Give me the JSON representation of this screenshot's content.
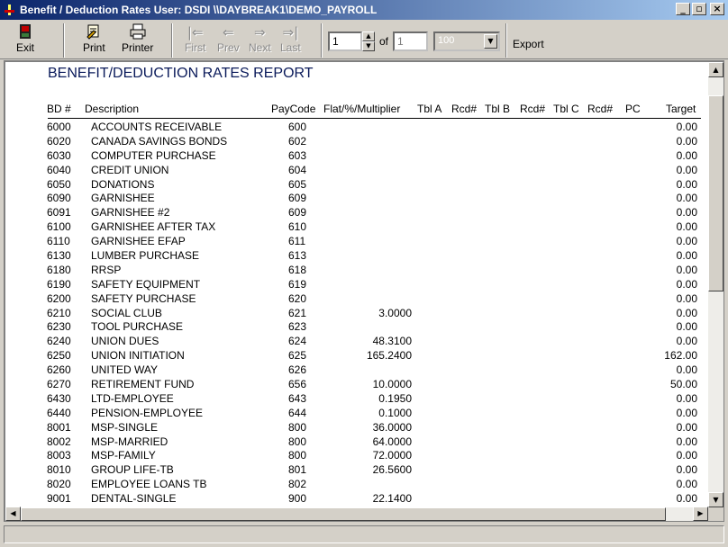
{
  "window": {
    "title": "Benefit / Deduction Rates  User: DSDI  \\\\DAYBREAK1\\DEMO_PAYROLL",
    "minimize": "_",
    "maximize": "▫",
    "close": "×"
  },
  "toolbar": {
    "exit": "Exit",
    "print": "Print",
    "printer": "Printer",
    "first": "First",
    "prev": "Prev",
    "next": "Next",
    "last": "Last",
    "page_value": "1",
    "of_label": "of",
    "total_pages": "1",
    "zoom_value": "100",
    "export": "Export"
  },
  "icons": {
    "exit": "exit-door-icon",
    "print": "print-preview-icon",
    "printer": "printer-icon",
    "first": "first-page-icon",
    "prev": "prev-arrow-icon",
    "next": "next-arrow-icon",
    "last": "last-page-icon"
  },
  "report": {
    "title": "BENEFIT/DEDUCTION RATES REPORT",
    "columns": {
      "bd": "BD  #",
      "description": "Description",
      "paycode": "PayCode",
      "flat": "Flat/%/Multiplier",
      "tbl_a": "Tbl A",
      "rcd1": "Rcd#",
      "tbl_b": "Tbl B",
      "rcd2": "Rcd#",
      "tbl_c": "Tbl C",
      "rcd3": "Rcd#",
      "pc": "PC",
      "target": "Target"
    },
    "rows": [
      {
        "bd": "6000",
        "desc": "ACCOUNTS RECEIVABLE",
        "paycode": "600",
        "flat": "",
        "target": "0.00"
      },
      {
        "bd": "6020",
        "desc": "CANADA SAVINGS BONDS",
        "paycode": "602",
        "flat": "",
        "target": "0.00"
      },
      {
        "bd": "6030",
        "desc": "COMPUTER PURCHASE",
        "paycode": "603",
        "flat": "",
        "target": "0.00"
      },
      {
        "bd": "6040",
        "desc": "CREDIT UNION",
        "paycode": "604",
        "flat": "",
        "target": "0.00"
      },
      {
        "bd": "6050",
        "desc": "DONATIONS",
        "paycode": "605",
        "flat": "",
        "target": "0.00"
      },
      {
        "bd": "6090",
        "desc": "GARNISHEE",
        "paycode": "609",
        "flat": "",
        "target": "0.00"
      },
      {
        "bd": "6091",
        "desc": "GARNISHEE #2",
        "paycode": "609",
        "flat": "",
        "target": "0.00"
      },
      {
        "bd": "6100",
        "desc": "GARNISHEE AFTER TAX",
        "paycode": "610",
        "flat": "",
        "target": "0.00"
      },
      {
        "bd": "6110",
        "desc": "GARNISHEE EFAP",
        "paycode": "611",
        "flat": "",
        "target": "0.00"
      },
      {
        "bd": "6130",
        "desc": "LUMBER PURCHASE",
        "paycode": "613",
        "flat": "",
        "target": "0.00"
      },
      {
        "bd": "6180",
        "desc": "RRSP",
        "paycode": "618",
        "flat": "",
        "target": "0.00"
      },
      {
        "bd": "6190",
        "desc": "SAFETY EQUIPMENT",
        "paycode": "619",
        "flat": "",
        "target": "0.00"
      },
      {
        "bd": "6200",
        "desc": "SAFETY PURCHASE",
        "paycode": "620",
        "flat": "",
        "target": "0.00"
      },
      {
        "bd": "6210",
        "desc": "SOCIAL CLUB",
        "paycode": "621",
        "flat": "3.0000",
        "target": "0.00"
      },
      {
        "bd": "6230",
        "desc": "TOOL PURCHASE",
        "paycode": "623",
        "flat": "",
        "target": "0.00"
      },
      {
        "bd": "6240",
        "desc": "UNION DUES",
        "paycode": "624",
        "flat": "48.3100",
        "target": "0.00"
      },
      {
        "bd": "6250",
        "desc": "UNION INITIATION",
        "paycode": "625",
        "flat": "165.2400",
        "target": "162.00"
      },
      {
        "bd": "6260",
        "desc": "UNITED WAY",
        "paycode": "626",
        "flat": "",
        "target": "0.00"
      },
      {
        "bd": "6270",
        "desc": "RETIREMENT FUND",
        "paycode": "656",
        "flat": "10.0000",
        "target": "50.00"
      },
      {
        "bd": "6430",
        "desc": "LTD-EMPLOYEE",
        "paycode": "643",
        "flat": "0.1950",
        "target": "0.00"
      },
      {
        "bd": "6440",
        "desc": "PENSION-EMPLOYEE",
        "paycode": "644",
        "flat": "0.1000",
        "target": "0.00"
      },
      {
        "bd": "8001",
        "desc": "MSP-SINGLE",
        "paycode": "800",
        "flat": "36.0000",
        "target": "0.00"
      },
      {
        "bd": "8002",
        "desc": "MSP-MARRIED",
        "paycode": "800",
        "flat": "64.0000",
        "target": "0.00"
      },
      {
        "bd": "8003",
        "desc": "MSP-FAMILY",
        "paycode": "800",
        "flat": "72.0000",
        "target": "0.00"
      },
      {
        "bd": "8010",
        "desc": "GROUP LIFE-TB",
        "paycode": "801",
        "flat": "26.5600",
        "target": "0.00"
      },
      {
        "bd": "8020",
        "desc": "EMPLOYEE LOANS TB",
        "paycode": "802",
        "flat": "",
        "target": "0.00"
      },
      {
        "bd": "9001",
        "desc": "DENTAL-SINGLE",
        "paycode": "900",
        "flat": "22.1400",
        "target": "0.00"
      }
    ]
  }
}
